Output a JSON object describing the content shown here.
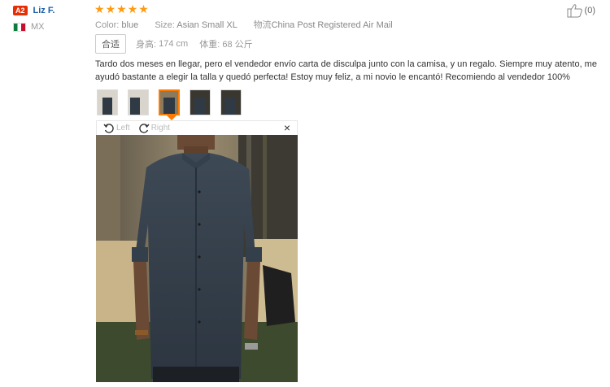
{
  "user": {
    "level_badge": "A2",
    "name": "Liz F.",
    "country": "MX"
  },
  "rating": {
    "stars": 5,
    "max": 5
  },
  "helpful": {
    "count_label": "(0)"
  },
  "attributes": {
    "color_label": "Color:",
    "color_value": "blue",
    "size_label": "Size:",
    "size_value": "Asian Small XL",
    "shipping_label": "物流",
    "shipping_value": "China Post Registered Air Mail"
  },
  "measurements": {
    "fit_tag": "合适",
    "height_label": "身高:",
    "height_value": "174 cm",
    "weight_label": "体重:",
    "weight_value": "68 公斤"
  },
  "comment": "Tardo dos meses en llegar, pero el vendedor envío carta de disculpa junto con la camisa, y un regalo. Siempre muy atento, me ayudó bastante a elegir la talla y quedó perfecta! Estoy muy feliz, a mi novio le encantó! Recomiendo al vendedor 100%",
  "viewer": {
    "rotate_left_label": "Left",
    "rotate_right_label": "Right",
    "close_symbol": "×",
    "active_thumbnail_index": 2
  },
  "colors": {
    "accent_orange": "#ff7a00",
    "star": "#ff9a0e",
    "link_blue": "#1a5ea6",
    "badge_red": "#e62e04"
  },
  "icons": [
    "thumbs-up-icon",
    "rotate-left-icon",
    "rotate-right-icon",
    "close-icon",
    "star-icon",
    "mexico-flag-icon"
  ]
}
